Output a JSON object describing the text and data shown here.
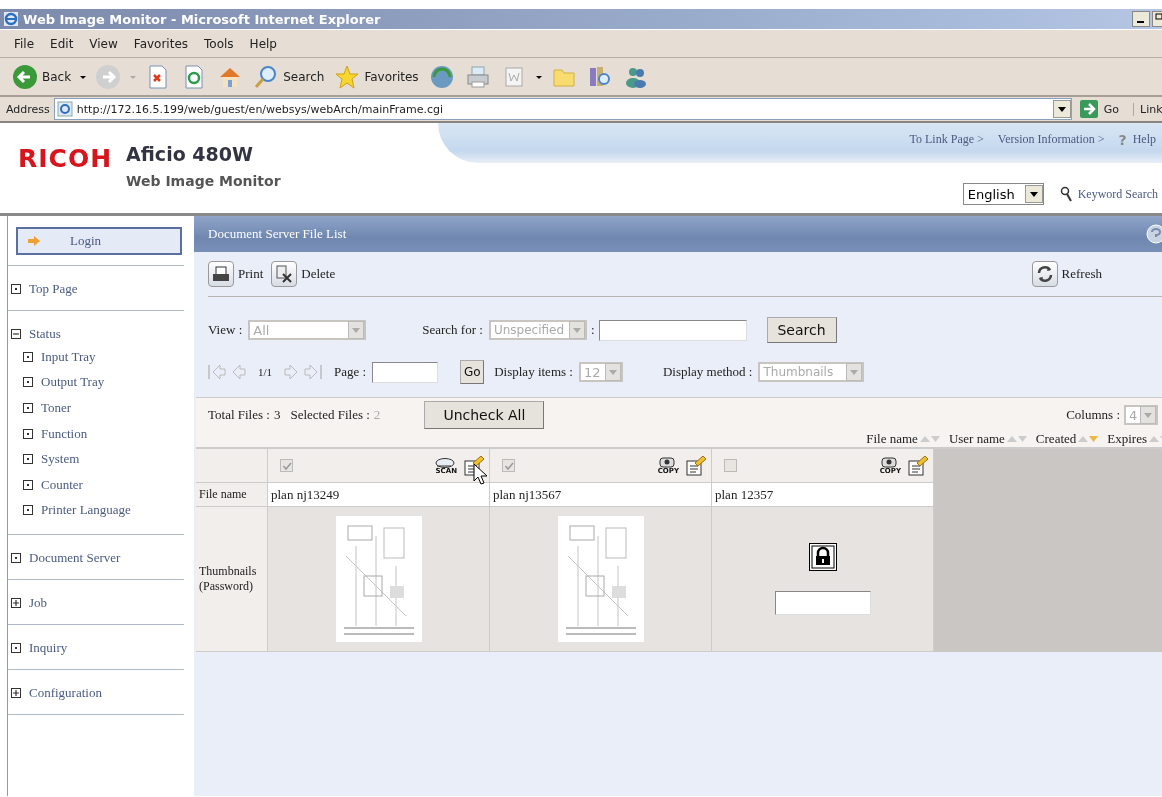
{
  "window": {
    "title": "Web Image Monitor - Microsoft Internet Explorer"
  },
  "menu": [
    "File",
    "Edit",
    "View",
    "Favorites",
    "Tools",
    "Help"
  ],
  "toolbar": [
    {
      "kind": "back",
      "label": "Back"
    },
    {
      "kind": "forward"
    },
    {
      "kind": "stop"
    },
    {
      "kind": "refresh"
    },
    {
      "kind": "home"
    },
    {
      "kind": "search",
      "label": "Search"
    },
    {
      "kind": "favorites",
      "label": "Favorites"
    },
    {
      "kind": "media"
    },
    {
      "kind": "print"
    },
    {
      "kind": "word"
    },
    {
      "kind": "folder"
    },
    {
      "kind": "research"
    },
    {
      "kind": "messenger"
    }
  ],
  "address": {
    "label": "Address",
    "value": "http://172.16.5.199/web/guest/en/websys/webArch/mainFrame.cgi",
    "go": "Go",
    "links": "Link"
  },
  "header": {
    "logo": "RICOH",
    "model": "Aficio 480W",
    "product": "Web Image Monitor",
    "links": [
      "To Link Page >",
      "Version Information >"
    ],
    "help_mark": "?",
    "help": "Help",
    "language": "English",
    "keyword_search": "Keyword Search"
  },
  "sidebar": {
    "login": "Login",
    "items": [
      {
        "label": "Top Page",
        "kind": "page"
      },
      {
        "label": "Status",
        "kind": "group",
        "expanded": true,
        "children": [
          {
            "label": "Input Tray",
            "kind": "page"
          },
          {
            "label": "Output Tray",
            "kind": "page"
          },
          {
            "label": "Toner",
            "kind": "page"
          },
          {
            "label": "Function",
            "kind": "page"
          },
          {
            "label": "System",
            "kind": "page"
          },
          {
            "label": "Counter",
            "kind": "page"
          },
          {
            "label": "Printer Language",
            "kind": "page"
          }
        ]
      },
      {
        "label": "Document Server",
        "kind": "page"
      },
      {
        "label": "Job",
        "kind": "group",
        "expanded": false
      },
      {
        "label": "Inquiry",
        "kind": "page"
      },
      {
        "label": "Configuration",
        "kind": "group",
        "expanded": false
      }
    ]
  },
  "panel": {
    "title": "Document Server File List",
    "actions": [
      {
        "kind": "print",
        "label": "Print"
      },
      {
        "kind": "delete",
        "label": "Delete"
      }
    ],
    "refresh": "Refresh",
    "filters": {
      "view_label": "View :",
      "view": "All",
      "search_label": "Search for :",
      "search_scope": "Unspecified",
      "colon": ":",
      "search_button": "Search"
    },
    "pager": {
      "position": "1/1",
      "page_label": "Page :",
      "go": "Go",
      "items_label": "Display items :",
      "items": "12",
      "method_label": "Display method :",
      "method": "Thumbnails"
    },
    "summary": {
      "total_label": "Total Files :",
      "total": "3",
      "selected_label": "Selected Files :",
      "selected": "2",
      "uncheck": "Uncheck All",
      "columns_label": "Columns :",
      "columns": "4"
    },
    "sort": [
      {
        "label": "File name",
        "active": false
      },
      {
        "label": "User name",
        "active": false
      },
      {
        "label": "Created",
        "active": true
      },
      {
        "label": "Expires",
        "active": false
      }
    ],
    "grid": {
      "row_labels": [
        "File name",
        "Thumbnails (Password)"
      ],
      "files": [
        {
          "name": "plan nj13249",
          "checked": true,
          "kind": "scan",
          "job": "SCAN",
          "locked": false
        },
        {
          "name": "plan nj13567",
          "checked": true,
          "kind": "copy",
          "job": "COPY",
          "locked": false
        },
        {
          "name": "plan 12357",
          "checked": false,
          "kind": "copy",
          "job": "COPY",
          "locked": true
        }
      ]
    }
  }
}
